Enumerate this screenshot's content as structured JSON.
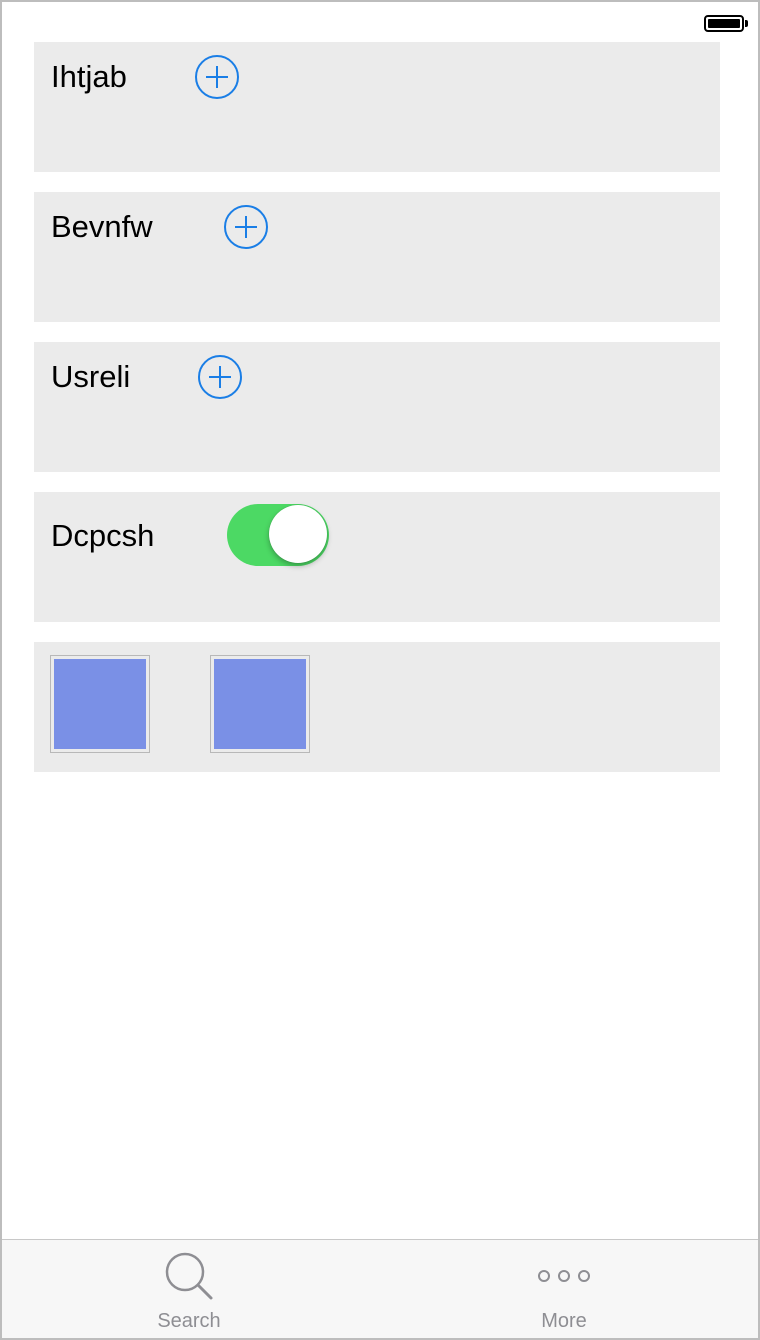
{
  "status_bar": {
    "battery_level": 1.0
  },
  "rows": [
    {
      "label": "Ihtjab",
      "control": "add-button"
    },
    {
      "label": "Bevnfw",
      "control": "add-button"
    },
    {
      "label": "Usreli",
      "control": "add-button"
    },
    {
      "label": "Dcpcsh",
      "control": "toggle",
      "toggle_on": true
    }
  ],
  "swatches": {
    "color": "#7a90e6",
    "count": 2
  },
  "colors": {
    "accent": "#1a7ee6",
    "toggle_on": "#4cd964",
    "card_bg": "#ebebeb"
  },
  "tabbar": {
    "tabs": [
      {
        "label": "Search",
        "icon": "search-icon"
      },
      {
        "label": "More",
        "icon": "more-icon"
      }
    ]
  }
}
